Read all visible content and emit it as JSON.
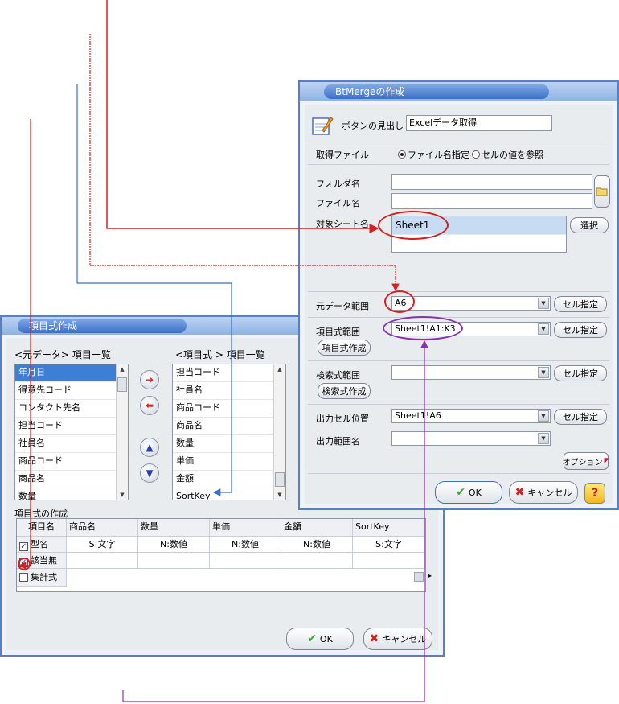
{
  "colors": {
    "red_line": "#d42020",
    "blue_line": "#3a6fc8",
    "purple_line": "#8a2fb0",
    "title_blue": "#3d6fc4"
  },
  "main_dialog": {
    "title": "BtMergeの作成",
    "button_caption_label": "ボタンの見出し",
    "button_caption_value": "Excelデータ取得",
    "source_file_label": "取得ファイル",
    "radio_filename": "ファイル名指定",
    "radio_cell": "セルの値を参照",
    "folder_label": "フォルダ名",
    "file_label": "ファイル名",
    "folder_value": "",
    "file_value": "",
    "sheet_label": "対象シート名",
    "sheet_items": [
      "Sheet1"
    ],
    "select_button": "選択",
    "source_range_label": "元データ範囲",
    "source_range_value": "A6",
    "cell_specify": "セル指定",
    "item_formula_range_label": "項目式範囲",
    "item_formula_range_value": "Sheet1!A1:K3",
    "item_formula_create": "項目式作成",
    "search_range_label": "検索式範囲",
    "search_range_value": "",
    "search_formula_create": "検索式作成",
    "output_cell_label": "出力セル位置",
    "output_cell_value": "Sheet1!A6",
    "output_range_name_label": "出力範囲名",
    "output_range_name_value": "",
    "option_button": "オプション",
    "ok": "OK",
    "cancel": "キャンセル",
    "help": "?"
  },
  "item_dialog": {
    "title": "項目式作成",
    "left_header": "<元データ> 項目一覧",
    "right_header": "<項目式 > 項目一覧",
    "left_items": [
      "年月日",
      "得意先コード",
      "コンタクト先名",
      "担当コード",
      "社員名",
      "商品コード",
      "商品名",
      "数量"
    ],
    "right_items": [
      "担当コード",
      "社員名",
      "商品コード",
      "商品名",
      "数量",
      "単価",
      "金額",
      "SortKey"
    ],
    "formula_section_label": "項目式の作成",
    "grid_corner": "項目名",
    "grid_columns": [
      "商品名",
      "数量",
      "単価",
      "金額",
      "SortKey"
    ],
    "grid_types": [
      "S:文字",
      "N:数値",
      "N:数値",
      "N:数値",
      "S:文字"
    ],
    "row_labels": [
      {
        "label": "型名",
        "checked": true
      },
      {
        "label": "該当無",
        "checked": true
      },
      {
        "label": "集計式",
        "checked": false
      }
    ],
    "ok": "OK",
    "cancel": "キャンセル"
  }
}
